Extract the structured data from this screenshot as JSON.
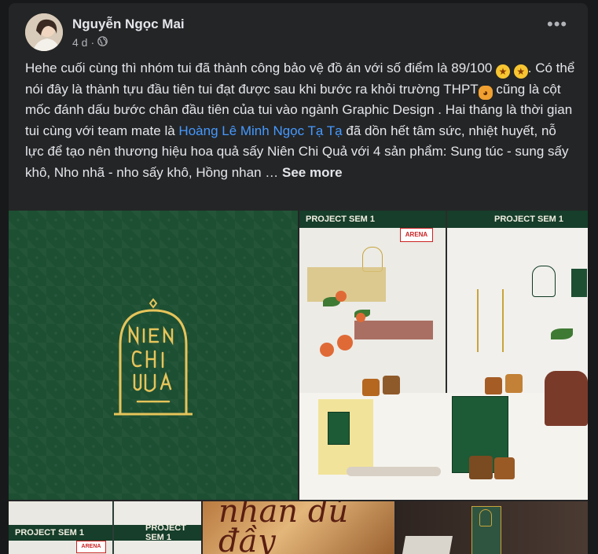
{
  "post": {
    "author": "Nguyễn Ngọc Mai",
    "time": "4 d",
    "privacy_icon": "globe-icon",
    "more_icon": "more-options-icon",
    "text": {
      "part1": "Hehe cuối cùng thì nhóm tui đã thành công bảo vệ đồ án với số điểm là 89/100",
      "part2": ". Có thể nói đây là thành tựu đầu tiên tui đạt được sau khi bước ra khỏi trường THPT",
      "part3": " cũng là cột mốc đánh dấu bước chân đầu tiên của tui vào ngành Graphic Design . Hai tháng là thời gian tui cùng với team mate là",
      "mention": "Hoàng Lê Minh Ngọc Tạ Tạ",
      "part4": "đã dồn hết tâm sức, nhiệt huyết, nỗ lực để tạo nên thương hiệu hoa quả sấy Niên Chi Quả với 4 sản phẩm: Sung túc - sung sấy khô, Nho nhã - nho sấy khô, Hồng nhan …",
      "see_more": "See more"
    },
    "emojis": [
      "star-struck-emoji",
      "star-struck-emoji",
      "cat-emoji"
    ]
  },
  "photos": {
    "photo1": {
      "logo_text": "NIÊN CHI QUẢ",
      "bg_color": "#1d4f33",
      "accent_color": "#e6c45a"
    },
    "photo2": {
      "banner_left": "PROJECT SEM 1",
      "banner_right": "PROJECT SEM 1",
      "badge": "ARENA"
    },
    "photo3": {
      "banner_left": "PROJECT SEM 1",
      "banner_right": "PROJECT SEM 1",
      "badge": "ARENA"
    },
    "photo4": {
      "script_text": "nhan dủ đầy"
    },
    "photo5": {}
  }
}
